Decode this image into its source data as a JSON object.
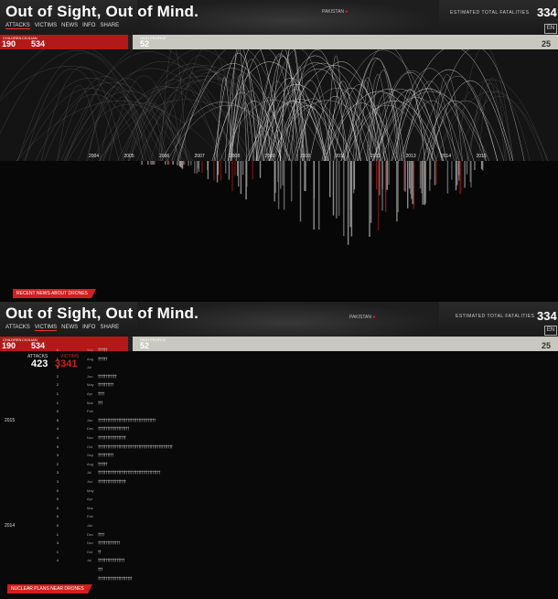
{
  "screen1": {
    "title": "Out of Sight, Out of Mind.",
    "nav": [
      "ATTACKS",
      "VICTIMS",
      "NEWS",
      "INFO",
      "SHARE"
    ],
    "active_nav": "ATTACKS",
    "pakistan": "PAKISTAN",
    "estimated_label": "ESTIMATED TOTAL FATALITIES",
    "estimated_value": "334",
    "lang": "EN",
    "children_label": "CHILDREN",
    "children_value": "190",
    "civilian_label": "CIVILIAN",
    "civilian_value": "534",
    "high_profile_label": "HIGH PROFILE",
    "high_profile_value": "52",
    "other_value": "25",
    "years": [
      "2004",
      "2005",
      "2006",
      "2007",
      "2008",
      "2009",
      "2010",
      "2011",
      "2012",
      "2013",
      "2014",
      "2015"
    ],
    "bottom_tab": "RECENT NEWS ABOUT DRONES"
  },
  "screen2": {
    "title": "Out of Sight, Out of Mind.",
    "nav": [
      "ATTACKS",
      "VICTIMS",
      "NEWS",
      "INFO",
      "SHARE"
    ],
    "active_nav": "VICTIMS",
    "pakistan": "PAKISTAN",
    "estimated_label": "ESTIMATED TOTAL FATALITIES",
    "estimated_value": "334",
    "lang": "EN",
    "children_label": "CHILDREN",
    "children_value": "190",
    "civilian_label": "CIVILIAN",
    "civilian_value": "534",
    "high_profile_label": "HIGH PROFILE",
    "high_profile_value": "52",
    "other_value": "25",
    "attacks_label": "ATTACKS",
    "victims_label": "VICTIMS",
    "attacks_total": "423",
    "victims_total": "3341",
    "bottom_tab": "NUCLEAR PLANS NEAR DRONES",
    "rows": [
      {
        "year": "",
        "attacks": "1",
        "victims": "",
        "month": "Sep",
        "figs": 6
      },
      {
        "year": "",
        "attacks": "1",
        "victims": "",
        "month": "Aug",
        "figs": 6
      },
      {
        "year": "",
        "attacks": "0",
        "victims": "",
        "month": "Jul",
        "figs": 0
      },
      {
        "year": "",
        "attacks": "2",
        "victims": "",
        "month": "Jun",
        "figs": 12
      },
      {
        "year": "",
        "attacks": "2",
        "victims": "",
        "month": "May",
        "figs": 10
      },
      {
        "year": "",
        "attacks": "1",
        "victims": "",
        "month": "Apr",
        "figs": 4
      },
      {
        "year": "",
        "attacks": "1",
        "victims": "",
        "month": "Mar",
        "figs": 3
      },
      {
        "year": "",
        "attacks": "0",
        "victims": "",
        "month": "Feb",
        "figs": 0
      },
      {
        "year": "2015",
        "attacks": "5",
        "victims": "",
        "month": "Jan",
        "figs": 37
      },
      {
        "year": "",
        "attacks": "4",
        "victims": "",
        "month": "Dec",
        "figs": 20
      },
      {
        "year": "",
        "attacks": "4",
        "victims": "",
        "month": "Nov",
        "figs": 18
      },
      {
        "year": "",
        "attacks": "9",
        "victims": "",
        "month": "Oct",
        "figs": 48
      },
      {
        "year": "",
        "attacks": "3",
        "victims": "",
        "month": "Sep",
        "figs": 10
      },
      {
        "year": "",
        "attacks": "2",
        "victims": "",
        "month": "Aug",
        "figs": 6
      },
      {
        "year": "",
        "attacks": "3",
        "victims": "",
        "month": "Jul",
        "figs": 40
      },
      {
        "year": "",
        "attacks": "3",
        "victims": "",
        "month": "Jun",
        "figs": 18
      },
      {
        "year": "",
        "attacks": "0",
        "victims": "",
        "month": "May",
        "figs": 0
      },
      {
        "year": "",
        "attacks": "0",
        "victims": "",
        "month": "Apr",
        "figs": 0
      },
      {
        "year": "",
        "attacks": "0",
        "victims": "",
        "month": "Mar",
        "figs": 0
      },
      {
        "year": "",
        "attacks": "0",
        "victims": "",
        "month": "Feb",
        "figs": 0
      },
      {
        "year": "2014",
        "attacks": "0",
        "victims": "",
        "month": "Jan",
        "figs": 0
      },
      {
        "year": "",
        "attacks": "1",
        "victims": "",
        "month": "Dec",
        "figs": 4
      },
      {
        "year": "",
        "attacks": "3",
        "victims": "",
        "month": "Nov",
        "figs": 14
      },
      {
        "year": "",
        "attacks": "1",
        "victims": "",
        "month": "Oct",
        "figs": 2
      },
      {
        "year": "",
        "attacks": "4",
        "victims": "",
        "month": "Jul",
        "figs": 17
      },
      {
        "year": "",
        "attacks": "",
        "victims": "",
        "month": "",
        "figs": 3
      },
      {
        "year": "",
        "attacks": "",
        "victims": "",
        "month": "",
        "figs": 22
      }
    ]
  },
  "colors": {
    "accent": "#d41e1e",
    "stat_red": "#b21a1a",
    "stat_gray": "#c8c8c0",
    "bg": "#0b0b0b"
  }
}
